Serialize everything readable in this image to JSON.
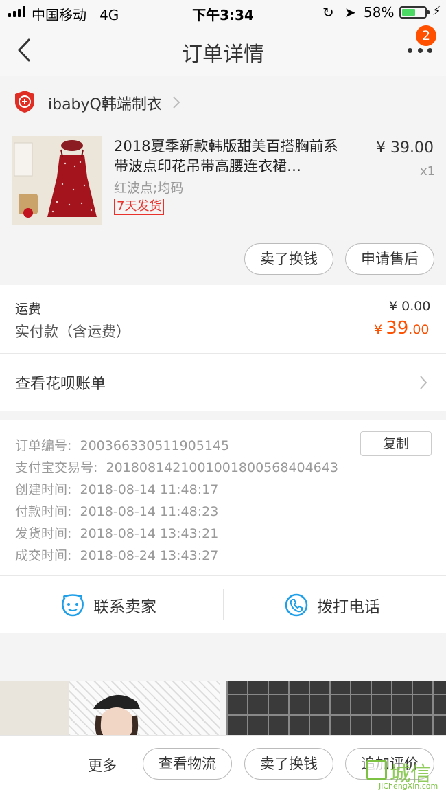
{
  "status_bar": {
    "carrier": "中国移动",
    "network": "4G",
    "time": "下午3:34",
    "battery": "58%",
    "battery_level": 0.58
  },
  "nav": {
    "title": "订单详情",
    "badge": "2"
  },
  "shop": {
    "name": "ibabyQ韩端制衣"
  },
  "product": {
    "title": "2018夏季新款韩版甜美百搭胸前系带波点印花吊带高腰连衣裙…",
    "spec": "红波点;均码",
    "tag": "7天发货",
    "price": "¥ 39.00",
    "qty": "x1",
    "sell_label": "卖了换钱",
    "after_sale_label": "申请售后"
  },
  "fee": {
    "shipping_label": "运费",
    "shipping_value": "¥ 0.00",
    "paid_label": "实付款（含运费）",
    "paid_currency": "¥",
    "paid_int": "39",
    "paid_dec": ".00"
  },
  "huabei": {
    "label": "查看花呗账单"
  },
  "order_info": {
    "rows": [
      {
        "label": "订单编号:",
        "value": "200366330511905145"
      },
      {
        "label": "支付宝交易号:",
        "value": "2018081421001001800568404643"
      },
      {
        "label": "创建时间:",
        "value": "2018-08-14 11:48:17"
      },
      {
        "label": "付款时间:",
        "value": "2018-08-14 11:48:23"
      },
      {
        "label": "发货时间:",
        "value": "2018-08-14 13:43:21"
      },
      {
        "label": "成交时间:",
        "value": "2018-08-24 13:43:27"
      }
    ],
    "copy_label": "复制"
  },
  "contact": {
    "seller_label": "联系卖家",
    "phone_label": "拨打电话"
  },
  "bottom_bar": {
    "more_label": "更多",
    "logistics_label": "查看物流",
    "sell_label": "卖了换钱",
    "review_label": "追加评价"
  },
  "watermark": {
    "cn": "城信",
    "en": "JiChengXin.com"
  },
  "colors": {
    "accent": "#ff5000",
    "tag_red": "#e8322b",
    "contact_blue": "#1e9fe8",
    "watermark_green": "#7dc242"
  }
}
